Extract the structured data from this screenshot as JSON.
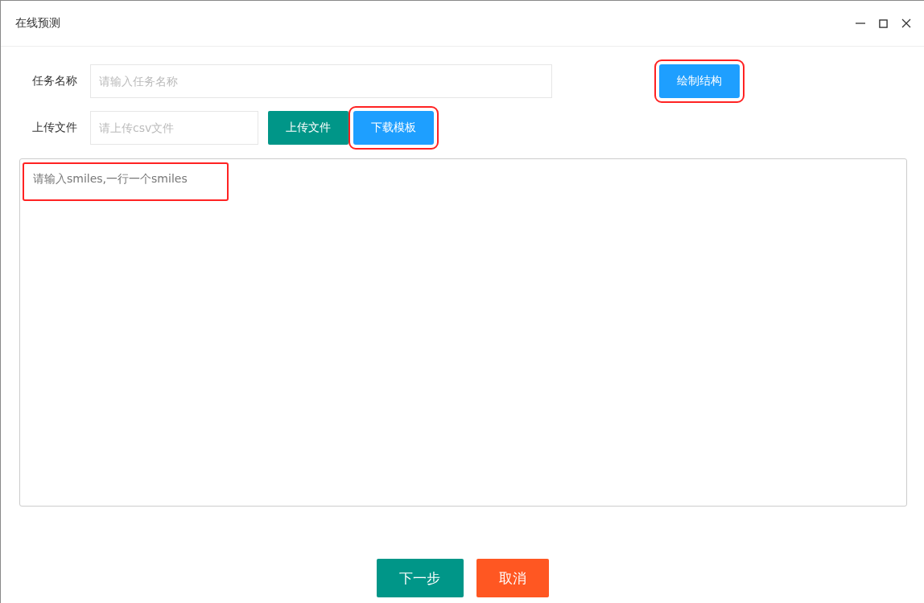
{
  "window": {
    "title": "在线预测"
  },
  "task_name": {
    "label": "任务名称",
    "placeholder": "请输入任务名称"
  },
  "draw_button": {
    "label": "绘制结构",
    "highlighted": true
  },
  "upload": {
    "label": "上传文件",
    "placeholder": "请上传csv文件"
  },
  "upload_button": {
    "label": "上传文件",
    "highlighted": false
  },
  "template_button": {
    "label": "下载模板",
    "highlighted": true
  },
  "smiles_input": {
    "placeholder": "请输入smiles,一行一个smiles",
    "highlighted": true
  },
  "buttons": [
    {
      "label": "下一步",
      "kind": "primary"
    },
    {
      "label": "取消",
      "kind": "danger"
    }
  ]
}
